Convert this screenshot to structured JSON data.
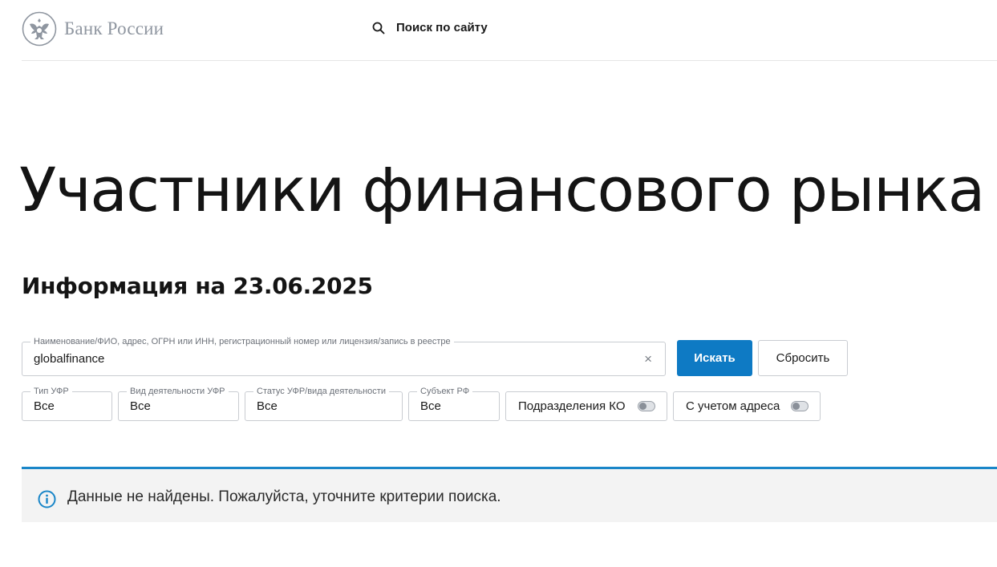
{
  "header": {
    "logo_text": "Банк России",
    "search_label": "Поиск по сайту"
  },
  "page": {
    "title": "Участники финансового рынка",
    "subtitle": "Информация на 23.06.2025"
  },
  "search": {
    "legend": "Наименование/ФИО, адрес, ОГРН или ИНН, регистрационный номер или лицензия/запись в реестре",
    "value": "globalfinance",
    "clear_symbol": "×",
    "search_button": "Искать",
    "reset_button": "Сбросить"
  },
  "filters": [
    {
      "legend": "Тип УФР",
      "value": "Все"
    },
    {
      "legend": "Вид деятельности УФР",
      "value": "Все"
    },
    {
      "legend": "Статус УФР/вида деятельности",
      "value": "Все"
    },
    {
      "legend": "Субъект РФ",
      "value": "Все"
    }
  ],
  "toggles": [
    {
      "label": "Подразделения КО",
      "on": false
    },
    {
      "label": "С учетом адреса",
      "on": false
    }
  ],
  "alert": {
    "icon": "info-icon",
    "text": "Данные не найдены. Пожалуйста, уточните критерии поиска."
  },
  "colors": {
    "accent": "#0e7ac4",
    "alert_border": "#1a86c8",
    "logo": "#8f96a0"
  }
}
